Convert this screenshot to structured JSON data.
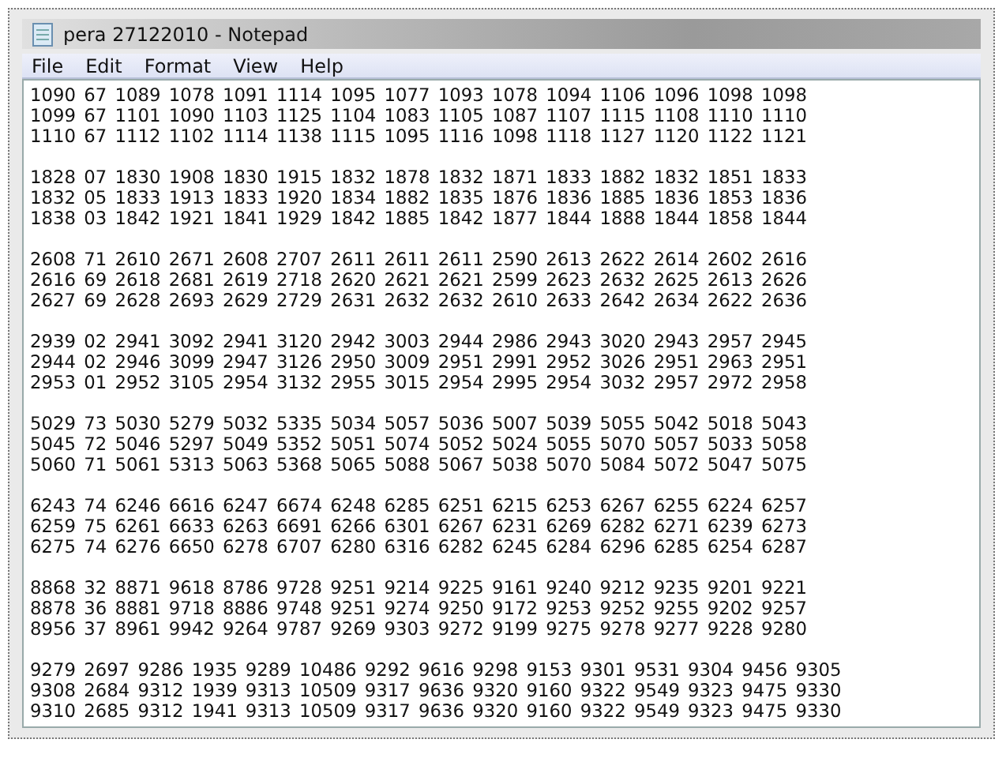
{
  "window": {
    "title": "pera 27122010 - Notepad"
  },
  "menu": [
    "File",
    "Edit",
    "Format",
    "View",
    "Help"
  ],
  "blocks": [
    [
      "1090 67 1089 1078 1091 1114 1095 1077 1093 1078 1094 1106 1096 1098 1098",
      "1099 67 1101 1090 1103 1125 1104 1083 1105 1087 1107 1115 1108 1110 1110",
      "1110 67 1112 1102 1114 1138 1115 1095 1116 1098 1118 1127 1120 1122 1121"
    ],
    [
      "1828 07 1830 1908 1830 1915 1832 1878 1832 1871 1833 1882 1832 1851 1833",
      "1832 05 1833 1913 1833 1920 1834 1882 1835 1876 1836 1885 1836 1853 1836",
      "1838 03 1842 1921 1841 1929 1842 1885 1842 1877 1844 1888 1844 1858 1844"
    ],
    [
      "2608 71 2610 2671 2608 2707 2611 2611 2611 2590 2613 2622 2614 2602 2616",
      "2616 69 2618 2681 2619 2718 2620 2621 2621 2599 2623 2632 2625 2613 2626",
      "2627 69 2628 2693 2629 2729 2631 2632 2632 2610 2633 2642 2634 2622 2636"
    ],
    [
      "2939 02 2941 3092 2941 3120 2942 3003 2944 2986 2943 3020 2943 2957 2945",
      "2944 02 2946 3099 2947 3126 2950 3009 2951 2991 2952 3026 2951 2963 2951",
      "2953 01 2952 3105 2954 3132 2955 3015 2954 2995 2954 3032 2957 2972 2958"
    ],
    [
      "5029 73 5030 5279 5032 5335 5034 5057 5036 5007 5039 5055 5042 5018 5043",
      "5045 72 5046 5297 5049 5352 5051 5074 5052 5024 5055 5070 5057 5033 5058",
      "5060 71 5061 5313 5063 5368 5065 5088 5067 5038 5070 5084 5072 5047 5075"
    ],
    [
      "6243 74 6246 6616 6247 6674 6248 6285 6251 6215 6253 6267 6255 6224 6257",
      "6259 75 6261 6633 6263 6691 6266 6301 6267 6231 6269 6282 6271 6239 6273",
      "6275 74 6276 6650 6278 6707 6280 6316 6282 6245 6284 6296 6285 6254 6287"
    ],
    [
      "8868 32 8871 9618 8786 9728 9251 9214 9225 9161 9240 9212 9235 9201 9221",
      "8878 36 8881 9718 8886 9748 9251 9274 9250 9172 9253 9252 9255 9202 9257",
      "8956 37 8961 9942 9264 9787 9269 9303 9272 9199 9275 9278 9277 9228 9280"
    ],
    [
      "9279 2697 9286 1935 9289 10486 9292 9616 9298 9153 9301 9531 9304 9456 9305",
      "9308 2684 9312 1939 9313 10509 9317 9636 9320 9160 9322 9549 9323 9475 9330",
      "9310 2685 9312 1941 9313 10509 9317 9636 9320 9160 9322 9549 9323 9475 9330"
    ]
  ]
}
